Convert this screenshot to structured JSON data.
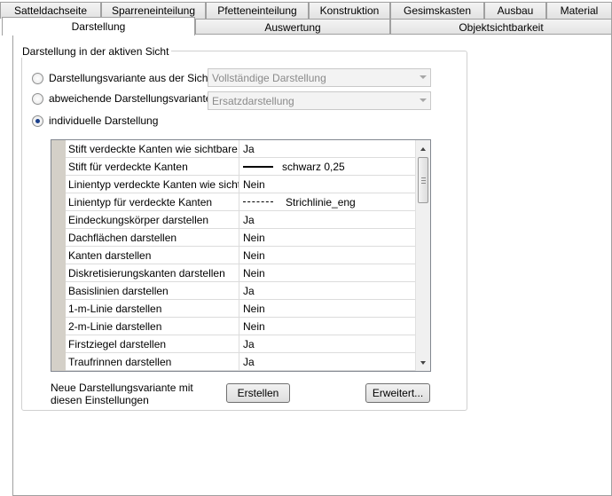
{
  "tabs_row1": [
    {
      "label": "Satteldachseite"
    },
    {
      "label": "Sparreneinteilung"
    },
    {
      "label": "Pfetteneinteilung"
    },
    {
      "label": "Konstruktion"
    },
    {
      "label": "Gesimskasten"
    },
    {
      "label": "Ausbau"
    },
    {
      "label": "Material"
    }
  ],
  "tabs_row2": [
    {
      "label": "Darstellung",
      "active": true
    },
    {
      "label": "Auswertung"
    },
    {
      "label": "Objektsichtbarkeit"
    }
  ],
  "group": {
    "title": "Darstellung in der aktiven Sicht",
    "options": [
      {
        "label": "Darstellungsvariante aus der Sicht",
        "checked": false,
        "combo": "Vollständige Darstellung"
      },
      {
        "label": "abweichende Darstellungsvariante",
        "checked": false,
        "combo": "Ersatzdarstellung"
      },
      {
        "label": "individuelle Darstellung",
        "checked": true
      }
    ]
  },
  "properties": [
    {
      "name": "Stift verdeckte Kanten wie sichtbare Kar",
      "value": "Ja"
    },
    {
      "name": "Stift für verdeckte Kanten",
      "value": "schwarz 0,25",
      "line": "solid"
    },
    {
      "name": "Linientyp verdeckte Kanten wie sichtbar",
      "value": "Nein"
    },
    {
      "name": "Linientyp für verdeckte Kanten",
      "value": "Strichlinie_eng",
      "line": "dash"
    },
    {
      "name": "Eindeckungskörper darstellen",
      "value": "Ja"
    },
    {
      "name": "Dachflächen darstellen",
      "value": "Nein"
    },
    {
      "name": "Kanten darstellen",
      "value": "Nein"
    },
    {
      "name": "Diskretisierungskanten darstellen",
      "value": "Nein"
    },
    {
      "name": "Basislinien darstellen",
      "value": "Ja"
    },
    {
      "name": "1-m-Linie darstellen",
      "value": "Nein"
    },
    {
      "name": "2-m-Linie darstellen",
      "value": "Nein"
    },
    {
      "name": "Firstziegel darstellen",
      "value": "Ja"
    },
    {
      "name": "Traufrinnen darstellen",
      "value": "Ja"
    }
  ],
  "footer": {
    "text": "Neue Darstellungsvariante mit diesen Einstellungen",
    "create_label": "Erstellen",
    "extended_label": "Erweitert..."
  }
}
